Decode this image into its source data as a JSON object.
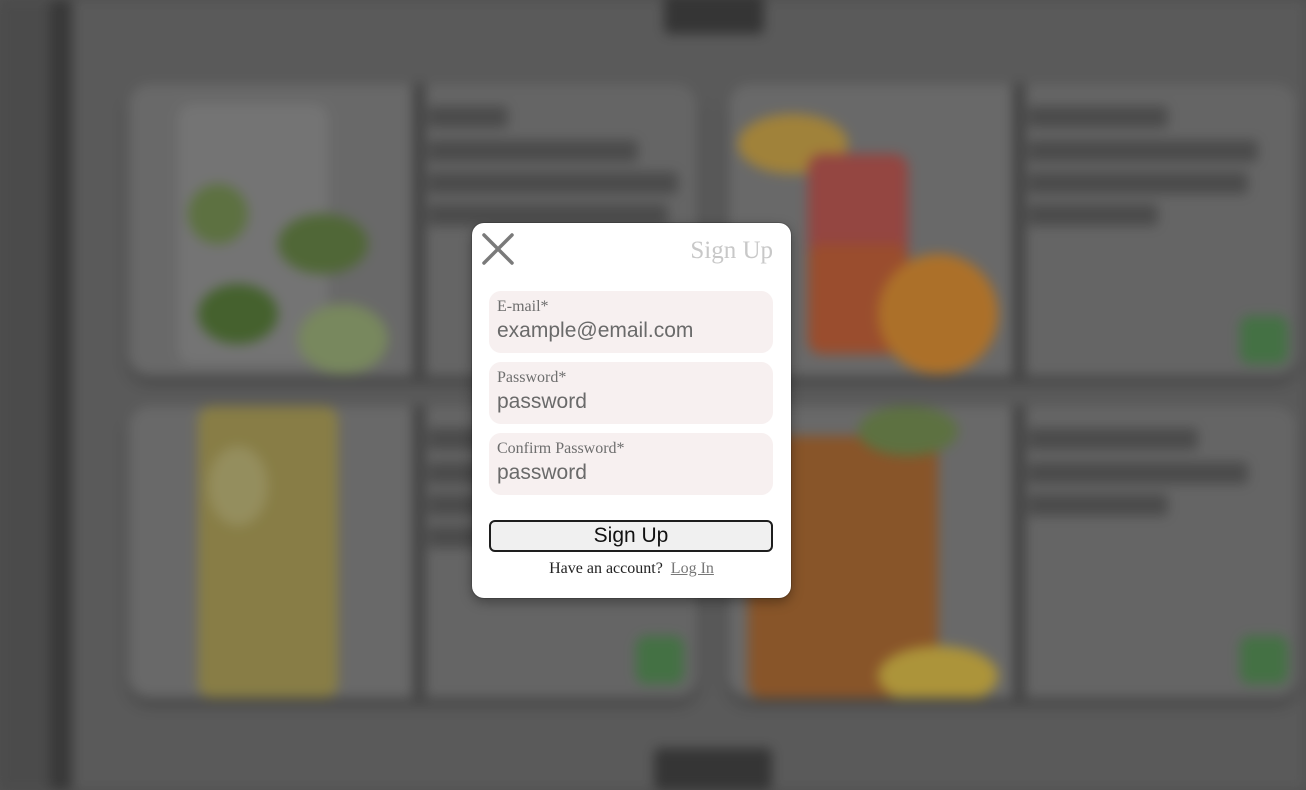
{
  "modal": {
    "title": "Sign Up",
    "close_icon": "close-icon",
    "fields": [
      {
        "label": "E-mail*",
        "placeholder": "example@email.com"
      },
      {
        "label": "Password*",
        "placeholder": "password"
      },
      {
        "label": "Confirm Password*",
        "placeholder": "password"
      }
    ],
    "submit_label": "Sign Up",
    "footer_text": "Have an account?",
    "footer_link": "Log In"
  },
  "colors": {
    "accent_green": "#4e8a4e",
    "modal_background": "#ffffff",
    "field_background": "#f7f0f0",
    "title_color": "#c8c8c8"
  }
}
